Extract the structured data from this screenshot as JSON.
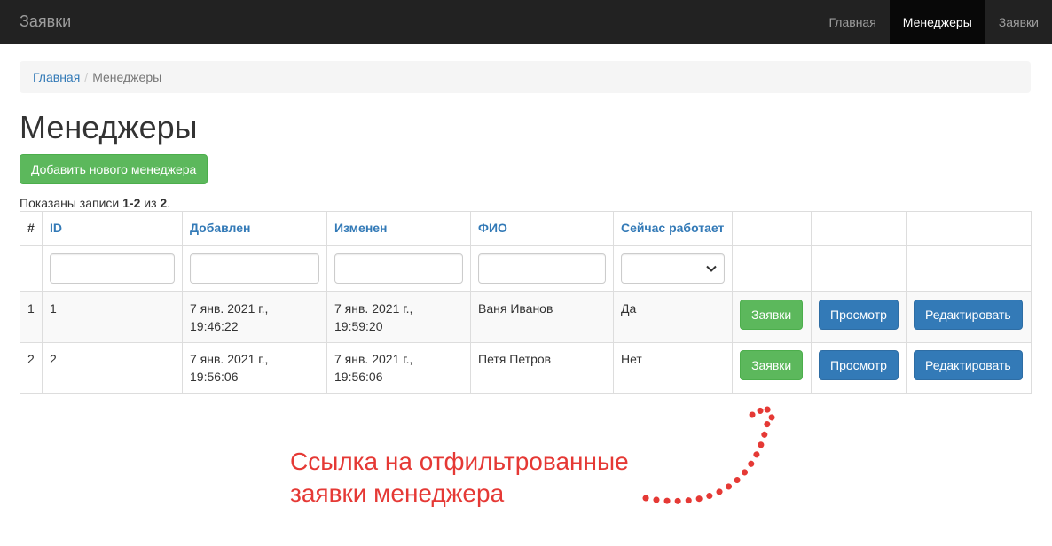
{
  "navbar": {
    "brand": "Заявки",
    "items": [
      {
        "label": "Главная"
      },
      {
        "label": "Менеджеры"
      },
      {
        "label": "Заявки"
      }
    ]
  },
  "breadcrumb": {
    "home": "Главная",
    "separator": "/",
    "current": "Менеджеры"
  },
  "page": {
    "title": "Менеджеры",
    "add_button": "Добавить нового менеджера",
    "summary": {
      "prefix": "Показаны записи ",
      "range": "1-2",
      "mid": " из ",
      "total": "2",
      "suffix": "."
    }
  },
  "table": {
    "headers": [
      "#",
      "ID",
      "Добавлен",
      "Изменен",
      "ФИО",
      "Сейчас работает"
    ],
    "filter_select_value": "",
    "rows": [
      {
        "num": "1",
        "id": "1",
        "added": "7 янв. 2021 г., 19:46:22",
        "changed": "7 янв. 2021 г., 19:59:20",
        "name": "Ваня Иванов",
        "working": "Да"
      },
      {
        "num": "2",
        "id": "2",
        "added": "7 янв. 2021 г., 19:56:06",
        "changed": "7 янв. 2021 г., 19:56:06",
        "name": "Петя Петров",
        "working": "Нет"
      }
    ],
    "actions": {
      "requests": "Заявки",
      "view": "Просмотр",
      "edit": "Редактировать"
    }
  },
  "annotation": {
    "line1": "Ссылка на отфильтрованные",
    "line2": "заявки менеджера"
  },
  "colors": {
    "navbar_bg": "#222222",
    "link": "#337ab7",
    "success": "#5cb85c",
    "primary": "#337ab7",
    "annotation": "#e53935"
  },
  "icons": {
    "select_arrow": "chevron-down-icon",
    "annotation_arrow": "dotted-arrow-icon"
  }
}
